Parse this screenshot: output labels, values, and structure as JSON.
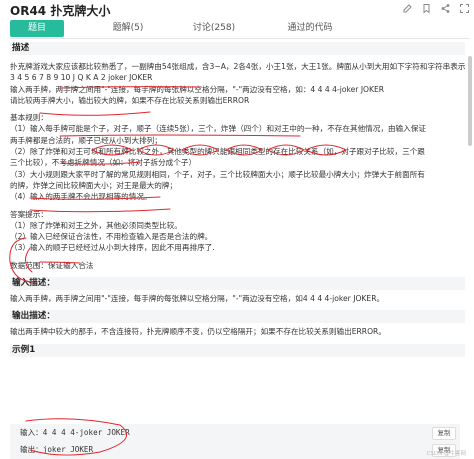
{
  "header": {
    "title": "OR44  扑克牌大小",
    "icons": [
      "edit-icon",
      "bookmark-icon",
      "share-icon",
      "fullscreen-icon"
    ]
  },
  "tabs": [
    {
      "label": "题目"
    },
    {
      "label": "题解(5)"
    },
    {
      "label": "讨论(258)"
    },
    {
      "label": "通过的代码"
    }
  ],
  "colors": {
    "accent": "#25bb9b",
    "annotation": "#e0262b"
  },
  "sections": {
    "description": {
      "heading": "描述",
      "lines": [
        "扑克牌游戏大家应该都比较熟悉了，一副牌由54张组成，含3~A，2各4张，小王1张，大王1张。牌面从小到大用如下字符和字符串表示（其中，小写joker表示小王，大写JOKER表示大王）：)",
        "3 4 5 6 7 8 9 10 J Q K A 2 joker JOKER",
        "输入两手牌，两手牌之间用\"-\"连接，每手牌的每张牌以空格分隔，\"-\"两边没有空格，如：4 4 4 4-joker JOKER",
        "请比较两手牌大小，输出较大的牌，如果不存在比较关系则输出ERROR"
      ],
      "rules_heading": "基本规则：",
      "rules": [
        "（1）输入每手牌可能是个子，对子，顺子（连续5张），三个，炸弹（四个）和对王中的一种，不存在其他情况，由输入保证",
        "两手牌都是合法的，顺子已经从小到大排列；",
        "（2）除了炸弹和对王可以和所有牌比较之外，其他类型的牌只能跟相同类型的存在比较关系（如，对子跟对子比较，三个跟",
        "三个比较），不考虑拆牌情况（如：将对子拆分成个子）",
        "（3）大小规则跟大家平时了解的常见规则相同，个子，对子，三个比较牌面大小；顺子比较最小牌大小；炸弹大于前面所有",
        "的牌，炸弹之间比较牌面大小；对王是最大的牌；",
        "（4）输入的两手牌不会出现相等的情况。"
      ],
      "hint_heading": "答案提示：",
      "hints": [
        "（1）除了炸弹和对王之外，其他必须同类型比较。",
        "（2）输入已经保证合法性，不用检查输入是否是合法的牌。",
        "（3）输入的顺子已经经过从小到大排序，因此不用再排序了."
      ],
      "data_range": "数据范围：保证输入合法"
    },
    "input": {
      "heading": "输入描述：",
      "text": "输入两手牌，两手牌之间用\"-\"连接，每手牌的每张牌以空格分隔，\"-\"两边没有空格，如4 4 4 4-joker JOKER。"
    },
    "output": {
      "heading": "输出描述：",
      "text": "输出两手牌中较大的那手，不含连接符，扑克牌顺序不变，仍以空格隔开；如果不存在比较关系则输出ERROR。"
    },
    "example": {
      "heading": "示例1",
      "input_label": "输入：",
      "input_value": "4 4 4 4-joker JOKER",
      "output_label": "输出：",
      "output_value": "joker JOKER",
      "copy_label": "复制"
    }
  },
  "watermark": "CSDN @牛客网"
}
